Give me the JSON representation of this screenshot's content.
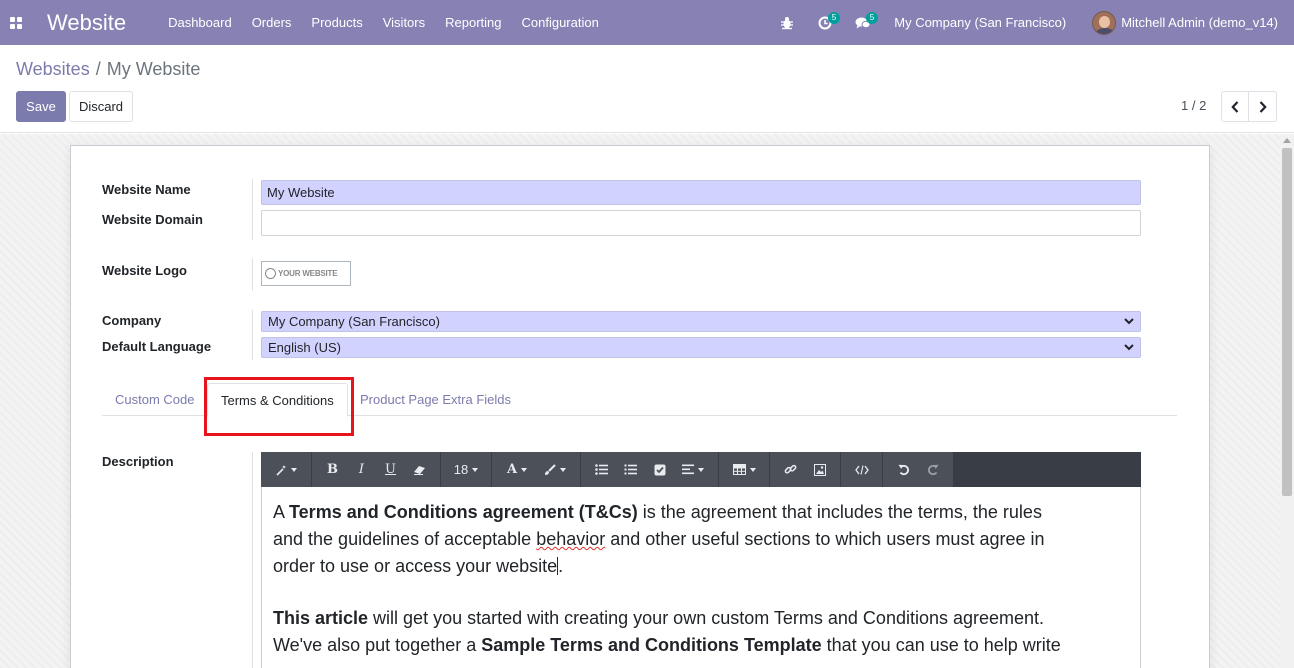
{
  "navbar": {
    "app_name": "Website",
    "menu": [
      "Dashboard",
      "Orders",
      "Products",
      "Visitors",
      "Reporting",
      "Configuration"
    ],
    "activity_count": "5",
    "messages_count": "5",
    "company": "My Company (San Francisco)",
    "user": "Mitchell Admin (demo_v14)"
  },
  "breadcrumb": {
    "parent": "Websites",
    "separator": "/",
    "current": "My Website"
  },
  "actions": {
    "save": "Save",
    "discard": "Discard"
  },
  "pager": {
    "value": "1 / 2"
  },
  "form": {
    "website_name_label": "Website Name",
    "website_name": "My Website",
    "website_domain_label": "Website Domain",
    "website_domain": "",
    "website_logo_label": "Website Logo",
    "logo_text": "YOUR WEBSITE",
    "company_label": "Company",
    "company": "My Company (San Francisco)",
    "language_label": "Default Language",
    "language": "English (US)"
  },
  "tabs": [
    "Custom Code",
    "Terms & Conditions",
    "Product Page Extra Fields"
  ],
  "active_tab": "Terms & Conditions",
  "description": {
    "label": "Description",
    "toolbar": {
      "font_size": "18"
    },
    "p1": {
      "t1": "A ",
      "b1": "Terms and Conditions agreement (T&Cs)",
      "t2": " is the agreement that includes the terms, the rules and the guidelines of acceptable ",
      "w1": "behavior",
      "t3": " other useful sections to which users must agree in order to use or access your website",
      "t4": "."
    },
    "p2": {
      "b1": "This article",
      "t1": " will get you started with creating your own custom Terms and Conditions agreement. We've also put together a ",
      "b2": "Sample Terms and Conditions Template",
      "t2": " that you can use to help write your own."
    }
  },
  "colors": {
    "navbar": "#8781b4",
    "primary": "#7c7bad",
    "required_field": "#d2d2ff",
    "highlight": "#e6151c",
    "toolbar": "#393e46"
  }
}
